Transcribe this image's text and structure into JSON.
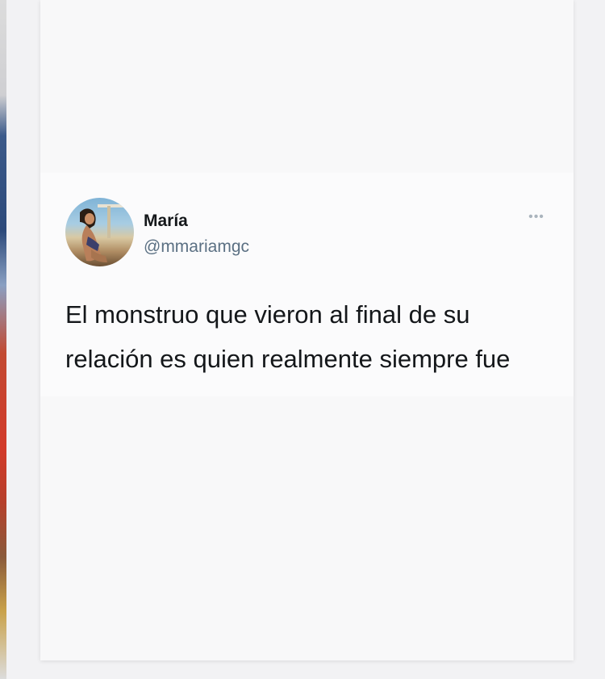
{
  "tweet": {
    "author_name": "María",
    "author_handle": "@mmariamgc",
    "text": "El monstruo que vieron al final de su relación es quien realmente siempre fue",
    "more_icon": "more-horizontal-icon"
  },
  "colors": {
    "text": "#14171a",
    "secondary": "#5b7083",
    "card_bg": "#f8f8f9"
  }
}
